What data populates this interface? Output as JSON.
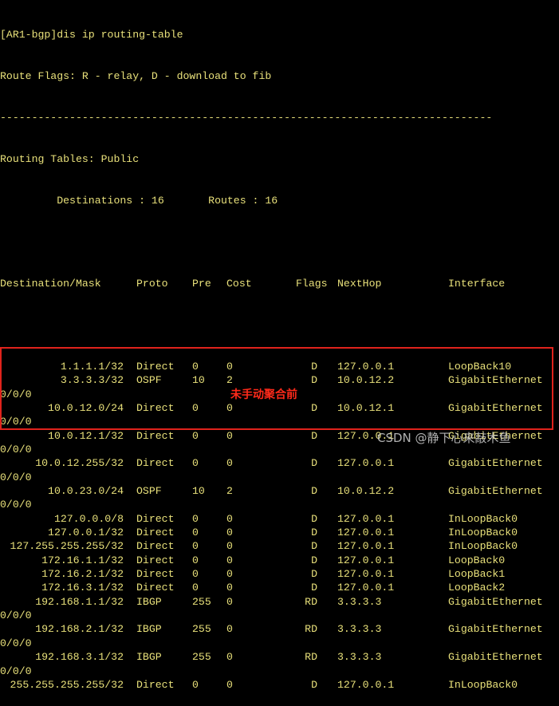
{
  "header": {
    "command_line": "[AR1-bgp]dis ip routing-table",
    "flags_legend": "Route Flags: R - relay, D - download to fib",
    "separator": "------------------------------------------------------------------------------",
    "tables_title": "Routing Tables: Public",
    "destinations_summary": "         Destinations : 16       Routes : 16"
  },
  "columns": {
    "destination": "Destination/Mask",
    "proto": "Proto",
    "pre": "Pre",
    "cost": "Cost",
    "flags": "Flags",
    "nexthop": "NextHop",
    "interface": "Interface"
  },
  "routes": [
    {
      "dest": "1.1.1.1/32",
      "proto": "Direct",
      "pre": "0",
      "cost": "0",
      "flags": "D",
      "nexthop": "127.0.0.1",
      "iface": "LoopBack10",
      "wrap": ""
    },
    {
      "dest": "3.3.3.3/32",
      "proto": "OSPF",
      "pre": "10",
      "cost": "2",
      "flags": "D",
      "nexthop": "10.0.12.2",
      "iface": "GigabitEthernet",
      "wrap": "0/0/0"
    },
    {
      "dest": "10.0.12.0/24",
      "proto": "Direct",
      "pre": "0",
      "cost": "0",
      "flags": "D",
      "nexthop": "10.0.12.1",
      "iface": "GigabitEthernet",
      "wrap": "0/0/0"
    },
    {
      "dest": "10.0.12.1/32",
      "proto": "Direct",
      "pre": "0",
      "cost": "0",
      "flags": "D",
      "nexthop": "127.0.0.1",
      "iface": "GigabitEthernet",
      "wrap": "0/0/0"
    },
    {
      "dest": "10.0.12.255/32",
      "proto": "Direct",
      "pre": "0",
      "cost": "0",
      "flags": "D",
      "nexthop": "127.0.0.1",
      "iface": "GigabitEthernet",
      "wrap": "0/0/0"
    },
    {
      "dest": "10.0.23.0/24",
      "proto": "OSPF",
      "pre": "10",
      "cost": "2",
      "flags": "D",
      "nexthop": "10.0.12.2",
      "iface": "GigabitEthernet",
      "wrap": "0/0/0"
    },
    {
      "dest": "127.0.0.0/8",
      "proto": "Direct",
      "pre": "0",
      "cost": "0",
      "flags": "D",
      "nexthop": "127.0.0.1",
      "iface": "InLoopBack0",
      "wrap": ""
    },
    {
      "dest": "127.0.0.1/32",
      "proto": "Direct",
      "pre": "0",
      "cost": "0",
      "flags": "D",
      "nexthop": "127.0.0.1",
      "iface": "InLoopBack0",
      "wrap": ""
    },
    {
      "dest": "127.255.255.255/32",
      "proto": "Direct",
      "pre": "0",
      "cost": "0",
      "flags": "D",
      "nexthop": "127.0.0.1",
      "iface": "InLoopBack0",
      "wrap": ""
    },
    {
      "dest": "172.16.1.1/32",
      "proto": "Direct",
      "pre": "0",
      "cost": "0",
      "flags": "D",
      "nexthop": "127.0.0.1",
      "iface": "LoopBack0",
      "wrap": ""
    },
    {
      "dest": "172.16.2.1/32",
      "proto": "Direct",
      "pre": "0",
      "cost": "0",
      "flags": "D",
      "nexthop": "127.0.0.1",
      "iface": "LoopBack1",
      "wrap": ""
    },
    {
      "dest": "172.16.3.1/32",
      "proto": "Direct",
      "pre": "0",
      "cost": "0",
      "flags": "D",
      "nexthop": "127.0.0.1",
      "iface": "LoopBack2",
      "wrap": ""
    },
    {
      "dest": "192.168.1.1/32",
      "proto": "IBGP",
      "pre": "255",
      "cost": "0",
      "flags": "RD",
      "nexthop": "3.3.3.3",
      "iface": "GigabitEthernet",
      "wrap": "0/0/0"
    },
    {
      "dest": "192.168.2.1/32",
      "proto": "IBGP",
      "pre": "255",
      "cost": "0",
      "flags": "RD",
      "nexthop": "3.3.3.3",
      "iface": "GigabitEthernet",
      "wrap": "0/0/0"
    },
    {
      "dest": "192.168.3.1/32",
      "proto": "IBGP",
      "pre": "255",
      "cost": "0",
      "flags": "RD",
      "nexthop": "3.3.3.3",
      "iface": "GigabitEthernet",
      "wrap": "0/0/0"
    },
    {
      "dest": "255.255.255.255/32",
      "proto": "Direct",
      "pre": "0",
      "cost": "0",
      "flags": "D",
      "nexthop": "127.0.0.1",
      "iface": "InLoopBack0",
      "wrap": ""
    }
  ],
  "annotation": {
    "text": "未手动聚合前",
    "color": "#ff2a1a"
  },
  "watermark": {
    "text": "CSDN @静下心来敲木鱼"
  },
  "colors": {
    "background": "#000000",
    "terminal_text": "#e8e07a",
    "highlight_border": "#e0231c"
  }
}
